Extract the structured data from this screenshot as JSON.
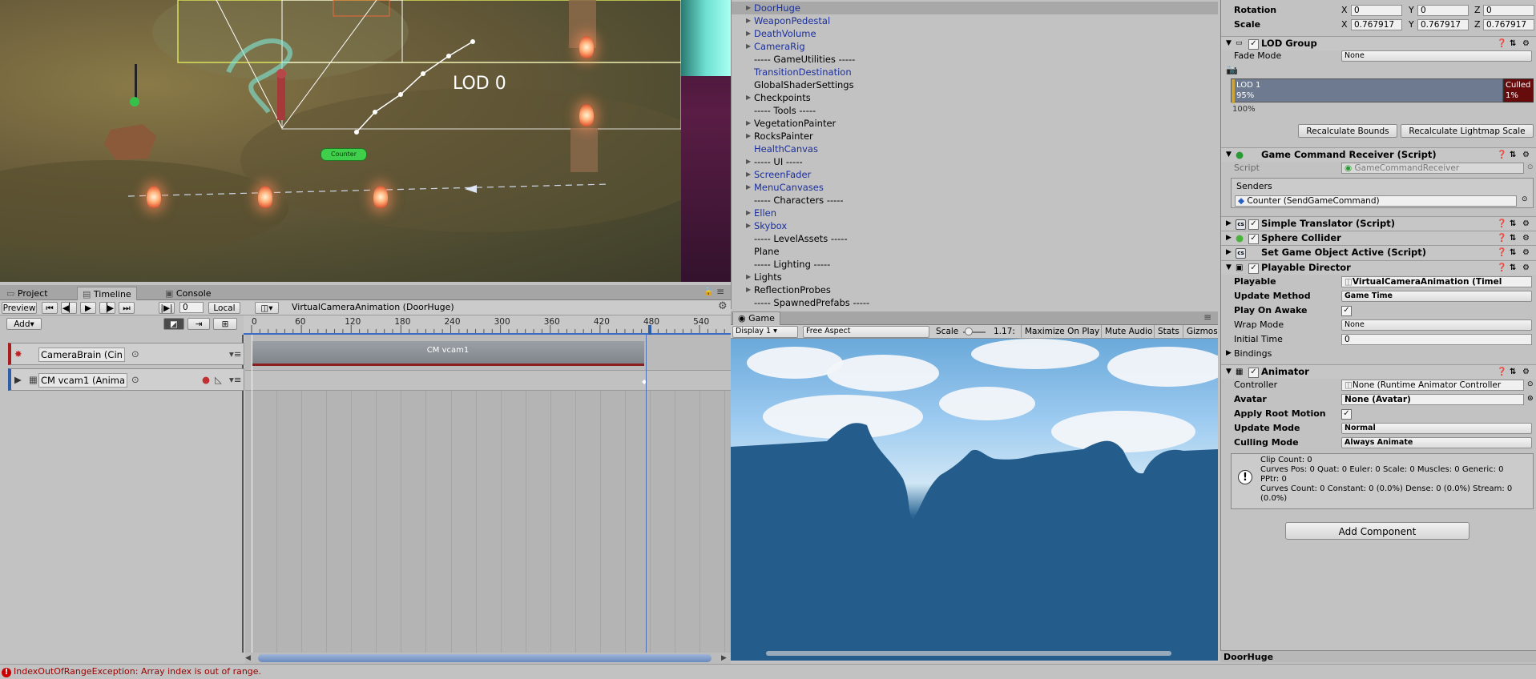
{
  "scene": {
    "lod_label": "LOD 0",
    "counter_badge": "Counter"
  },
  "hierarchy": {
    "items": [
      {
        "label": "DoorHuge",
        "expand": true,
        "blue": true,
        "selected": true
      },
      {
        "label": "WeaponPedestal",
        "expand": true,
        "blue": true
      },
      {
        "label": "DeathVolume",
        "expand": true,
        "blue": true
      },
      {
        "label": "CameraRig",
        "expand": true,
        "blue": true
      },
      {
        "label": "----- GameUtilities -----",
        "expand": false,
        "blue": false
      },
      {
        "label": "TransitionDestination",
        "expand": false,
        "blue": true
      },
      {
        "label": "GlobalShaderSettings",
        "expand": false,
        "blue": false
      },
      {
        "label": "Checkpoints",
        "expand": true,
        "blue": false
      },
      {
        "label": "----- Tools -----",
        "expand": false,
        "blue": false
      },
      {
        "label": "VegetationPainter",
        "expand": true,
        "blue": false
      },
      {
        "label": "RocksPainter",
        "expand": true,
        "blue": false
      },
      {
        "label": "HealthCanvas",
        "expand": false,
        "blue": true
      },
      {
        "label": "----- UI -----",
        "expand": true,
        "blue": false
      },
      {
        "label": "ScreenFader",
        "expand": true,
        "blue": true
      },
      {
        "label": "MenuCanvases",
        "expand": true,
        "blue": true
      },
      {
        "label": "----- Characters -----",
        "expand": false,
        "blue": false
      },
      {
        "label": "Ellen",
        "expand": true,
        "blue": true
      },
      {
        "label": "Skybox",
        "expand": true,
        "blue": true
      },
      {
        "label": "----- LevelAssets -----",
        "expand": false,
        "blue": false
      },
      {
        "label": "Plane",
        "expand": false,
        "blue": false
      },
      {
        "label": "----- Lighting -----",
        "expand": false,
        "blue": false
      },
      {
        "label": "Lights",
        "expand": true,
        "blue": false
      },
      {
        "label": "ReflectionProbes",
        "expand": true,
        "blue": false
      },
      {
        "label": "----- SpawnedPrefabs -----",
        "expand": false,
        "blue": false
      }
    ]
  },
  "timeline": {
    "tabs": [
      "Project",
      "Timeline",
      "Console"
    ],
    "preview_label": "Preview",
    "frame_value": "0",
    "local_label": "Local",
    "add_label": "Add",
    "asset_title": "VirtualCameraAnimation (DoorHuge)",
    "ruler_ticks": [
      "0",
      "60",
      "120",
      "180",
      "240",
      "300",
      "360",
      "420",
      "480",
      "540"
    ],
    "playhead_frame": 480,
    "tracks": [
      {
        "name": "CameraBrain (Cin"
      },
      {
        "name": "CM vcam1 (Anima"
      }
    ],
    "clip_label": "CM vcam1"
  },
  "game": {
    "tab_label": "Game",
    "display": "Display 1",
    "aspect": "Free Aspect",
    "scale_label": "Scale",
    "scale_value": "1.17:",
    "buttons": [
      "Maximize On Play",
      "Mute Audio",
      "Stats",
      "Gizmos"
    ]
  },
  "inspector": {
    "rotation": {
      "label": "Rotation",
      "x": "0",
      "y": "0",
      "z": "0"
    },
    "scale": {
      "label": "Scale",
      "x": "0.767917",
      "y": "0.767917",
      "z": "0.767917"
    },
    "lod_group": {
      "title": "LOD Group",
      "fade_mode_label": "Fade Mode",
      "fade_mode_value": "None",
      "lod1_label": "LOD 1",
      "lod1_percent": "95%",
      "culled_label": "Culled",
      "culled_percent": "1%",
      "hundred": "100%",
      "btn_bounds": "Recalculate Bounds",
      "btn_lightmap": "Recalculate Lightmap Scale"
    },
    "gcr": {
      "title": "Game Command Receiver (Script)",
      "script_label": "Script",
      "script_value": "GameCommandReceiver",
      "senders_label": "Senders",
      "sender_item": "Counter (SendGameCommand)"
    },
    "simple_translator": "Simple Translator (Script)",
    "sphere_collider": "Sphere Collider",
    "set_active": "Set Game Object Active (Script)",
    "playable_director": {
      "title": "Playable Director",
      "playable_label": "Playable",
      "playable_value": "VirtualCameraAnimation (Timel",
      "update_method_label": "Update Method",
      "update_method_value": "Game Time",
      "play_on_awake_label": "Play On Awake",
      "wrap_mode_label": "Wrap Mode",
      "wrap_mode_value": "None",
      "initial_time_label": "Initial Time",
      "initial_time_value": "0",
      "bindings_label": "Bindings"
    },
    "animator": {
      "title": "Animator",
      "controller_label": "Controller",
      "controller_value": "None (Runtime Animator Controller",
      "avatar_label": "Avatar",
      "avatar_value": "None (Avatar)",
      "root_motion_label": "Apply Root Motion",
      "update_mode_label": "Update Mode",
      "update_mode_value": "Normal",
      "culling_mode_label": "Culling Mode",
      "culling_mode_value": "Always Animate",
      "info_line1": "Clip Count: 0",
      "info_line2": "Curves Pos: 0 Quat: 0 Euler: 0 Scale: 0 Muscles: 0 Generic: 0",
      "info_line3": "PPtr: 0",
      "info_line4": "Curves Count: 0 Constant: 0 (0.0%) Dense: 0 (0.0%) Stream: 0",
      "info_line5": "(0.0%)"
    },
    "add_component": "Add Component",
    "footer_name": "DoorHuge"
  },
  "status": {
    "message": "IndexOutOfRangeException: Array index is out of range."
  }
}
